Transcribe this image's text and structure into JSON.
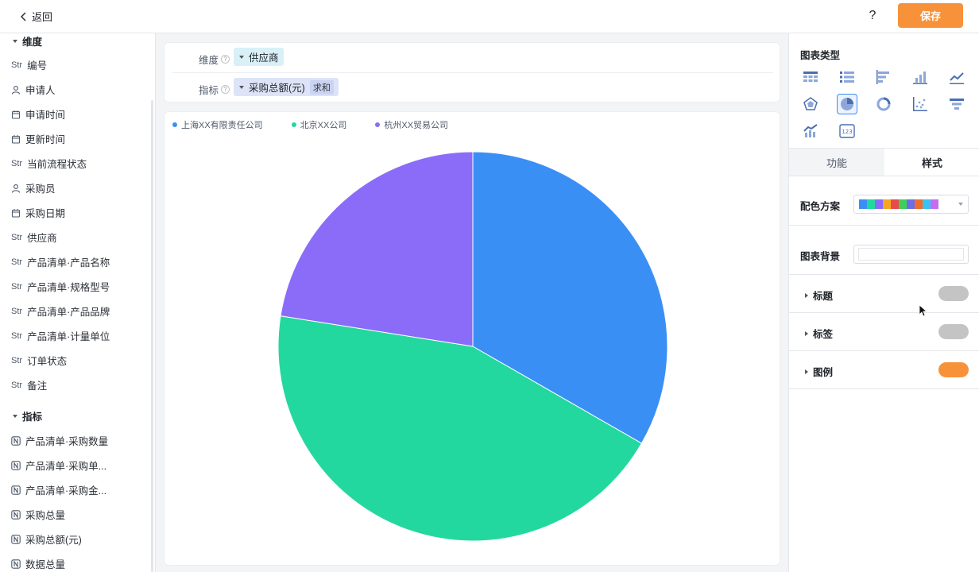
{
  "header": {
    "back_label": "返回",
    "help_label": "?",
    "save_label": "保存"
  },
  "sidebar": {
    "dimension_section": "维度",
    "dimensions": [
      {
        "type": "str",
        "label": "编号"
      },
      {
        "type": "user",
        "label": "申请人"
      },
      {
        "type": "date",
        "label": "申请时间"
      },
      {
        "type": "date",
        "label": "更新时间"
      },
      {
        "type": "str",
        "label": "当前流程状态"
      },
      {
        "type": "user",
        "label": "采购员"
      },
      {
        "type": "date",
        "label": "采购日期"
      },
      {
        "type": "str",
        "label": "供应商"
      },
      {
        "type": "str",
        "label": "产品清单·产品名称"
      },
      {
        "type": "str",
        "label": "产品清单·规格型号"
      },
      {
        "type": "str",
        "label": "产品清单·产品品牌"
      },
      {
        "type": "str",
        "label": "产品清单·计量单位"
      },
      {
        "type": "str",
        "label": "订单状态"
      },
      {
        "type": "str",
        "label": "备注"
      }
    ],
    "metric_section": "指标",
    "metrics": [
      {
        "type": "num",
        "label": "产品清单·采购数量"
      },
      {
        "type": "num",
        "label": "产品清单·采购单..."
      },
      {
        "type": "num",
        "label": "产品清单·采购金..."
      },
      {
        "type": "num",
        "label": "采购总量"
      },
      {
        "type": "num",
        "label": "采购总额(元)"
      },
      {
        "type": "num",
        "label": "数据总量"
      }
    ],
    "str_tag": "Str"
  },
  "config": {
    "dimension_label": "维度",
    "dimension_value": "供应商",
    "metric_label": "指标",
    "metric_value": "采购总额(元)",
    "metric_agg": "求和",
    "help_glyph": "?"
  },
  "chart_data": {
    "type": "pie",
    "title": "",
    "legend_position": "top-left",
    "slices": [
      {
        "label": "上海XX有限责任公司",
        "value": 33.3,
        "color": "#3a8ff5"
      },
      {
        "label": "北京XX公司",
        "value": 44.2,
        "color": "#23d89e"
      },
      {
        "label": "杭州XX贸易公司",
        "value": 22.5,
        "color": "#8b6cf9"
      }
    ]
  },
  "right_panel": {
    "chart_type_title": "图表类型",
    "chart_types": [
      "table-icon",
      "detail-table-icon",
      "horizontal-bar-icon",
      "bar-chart-icon",
      "line-chart-icon",
      "radar-chart-icon",
      "pie-chart-icon",
      "donut-chart-icon",
      "scatter-chart-icon",
      "funnel-chart-icon",
      "combo-chart-icon",
      "number-card-icon"
    ],
    "active_chart_type": "pie-chart-icon",
    "number_card_glyph": "123",
    "tabs": [
      "功能",
      "样式"
    ],
    "active_tab": "样式",
    "color_scheme_label": "配色方案",
    "color_scheme": [
      "#3a8ff5",
      "#23d89e",
      "#8b6cf9",
      "#f5a623",
      "#e84b4b",
      "#3fcf5a",
      "#6d6de8",
      "#f06d2b",
      "#3ac3f0",
      "#c56cf0"
    ],
    "background_label": "图表背景",
    "sections": [
      {
        "label": "标题",
        "enabled": false
      },
      {
        "label": "标签",
        "enabled": false
      },
      {
        "label": "图例",
        "enabled": true
      }
    ],
    "accent_color": "#f7923a"
  }
}
